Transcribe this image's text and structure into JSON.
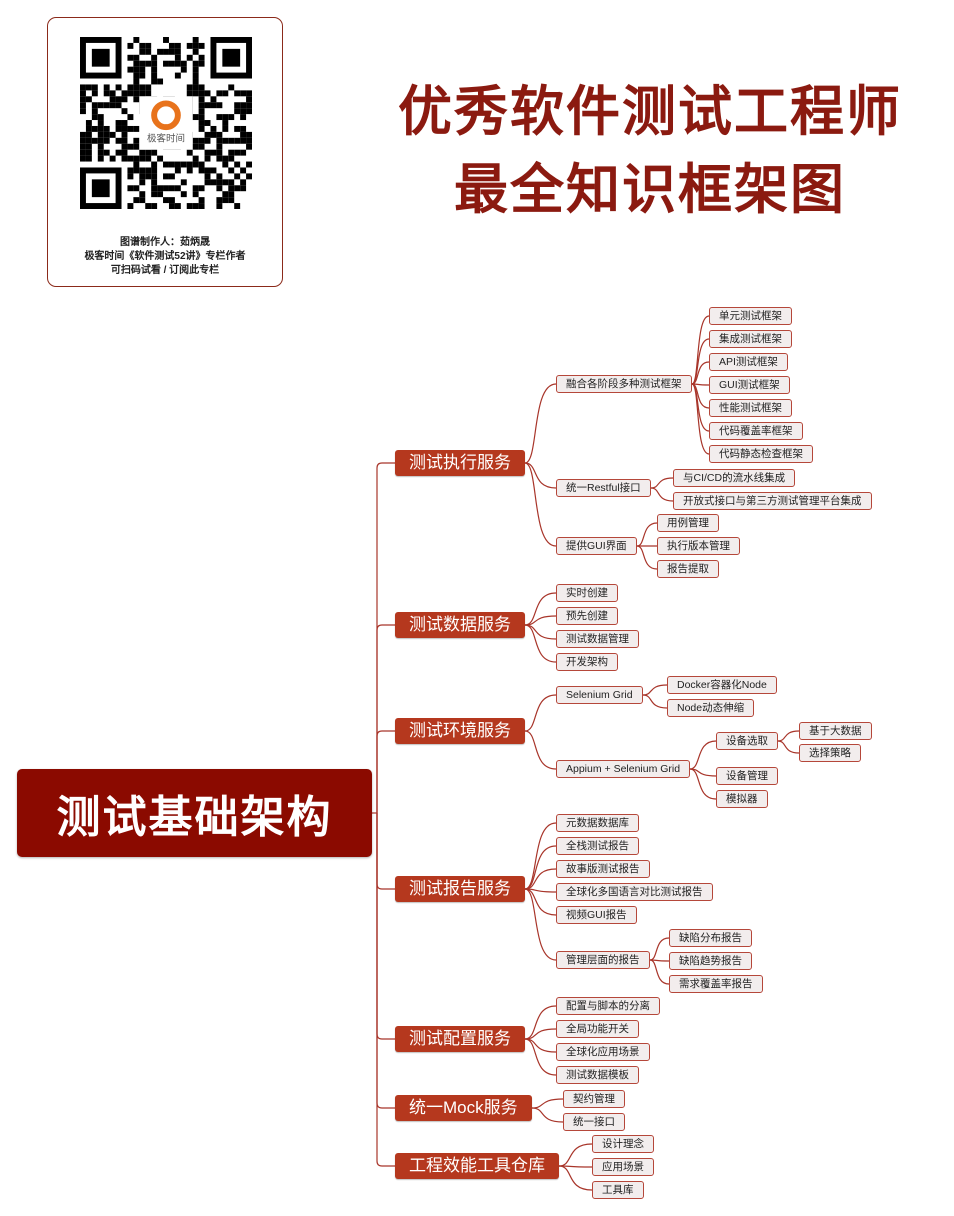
{
  "card": {
    "logo_text": "极客时间",
    "line1": "图谱制作人：茹炳晟",
    "line2": "极客时间《软件测试52讲》专栏作者",
    "line3": "可扫码试看 / 订阅此专栏"
  },
  "title": {
    "line1": "优秀软件测试工程师",
    "line2": "最全知识框架图"
  },
  "colors": {
    "title": "#8b1a10",
    "root": "#8b0a00",
    "branch": "#b5381e",
    "line": "#a8352a",
    "leaf_bg": "#f2eded"
  },
  "root": {
    "label": "测试基础架构"
  },
  "branches": [
    {
      "label": "测试执行服务",
      "children": [
        {
          "label": "融合各阶段多种测试框架",
          "children": [
            {
              "label": "单元测试框架"
            },
            {
              "label": "集成测试框架"
            },
            {
              "label": "API测试框架"
            },
            {
              "label": "GUI测试框架"
            },
            {
              "label": "性能测试框架"
            },
            {
              "label": "代码覆盖率框架"
            },
            {
              "label": "代码静态检查框架"
            }
          ]
        },
        {
          "label": "统一Restful接口",
          "children": [
            {
              "label": "与CI/CD的流水线集成"
            },
            {
              "label": "开放式接口与第三方测试管理平台集成"
            }
          ]
        },
        {
          "label": "提供GUI界面",
          "children": [
            {
              "label": "用例管理"
            },
            {
              "label": "执行版本管理"
            },
            {
              "label": "报告提取"
            }
          ]
        }
      ]
    },
    {
      "label": "测试数据服务",
      "children": [
        {
          "label": "实时创建"
        },
        {
          "label": "预先创建"
        },
        {
          "label": "测试数据管理"
        },
        {
          "label": "开发架构"
        }
      ]
    },
    {
      "label": "测试环境服务",
      "children": [
        {
          "label": "Selenium Grid",
          "children": [
            {
              "label": "Docker容器化Node"
            },
            {
              "label": "Node动态伸缩"
            }
          ]
        },
        {
          "label": "Appium + Selenium Grid",
          "children": [
            {
              "label": "设备选取",
              "children": [
                {
                  "label": "基于大数据"
                },
                {
                  "label": "选择策略"
                }
              ]
            },
            {
              "label": "设备管理"
            },
            {
              "label": "模拟器"
            }
          ]
        }
      ]
    },
    {
      "label": "测试报告服务",
      "children": [
        {
          "label": "元数据数据库"
        },
        {
          "label": "全栈测试报告"
        },
        {
          "label": "故事版测试报告"
        },
        {
          "label": "全球化多国语言对比测试报告"
        },
        {
          "label": "视频GUI报告"
        },
        {
          "label": "管理层面的报告",
          "children": [
            {
              "label": "缺陷分布报告"
            },
            {
              "label": "缺陷趋势报告"
            },
            {
              "label": "需求覆盖率报告"
            }
          ]
        }
      ]
    },
    {
      "label": "测试配置服务",
      "children": [
        {
          "label": "配置与脚本的分离"
        },
        {
          "label": "全局功能开关"
        },
        {
          "label": "全球化应用场景"
        },
        {
          "label": "测试数据模板"
        }
      ]
    },
    {
      "label": "统一Mock服务",
      "children": [
        {
          "label": "契约管理"
        },
        {
          "label": "统一接口"
        }
      ]
    },
    {
      "label": "工程效能工具仓库",
      "children": [
        {
          "label": "设计理念"
        },
        {
          "label": "应用场景"
        },
        {
          "label": "工具库"
        }
      ]
    }
  ]
}
